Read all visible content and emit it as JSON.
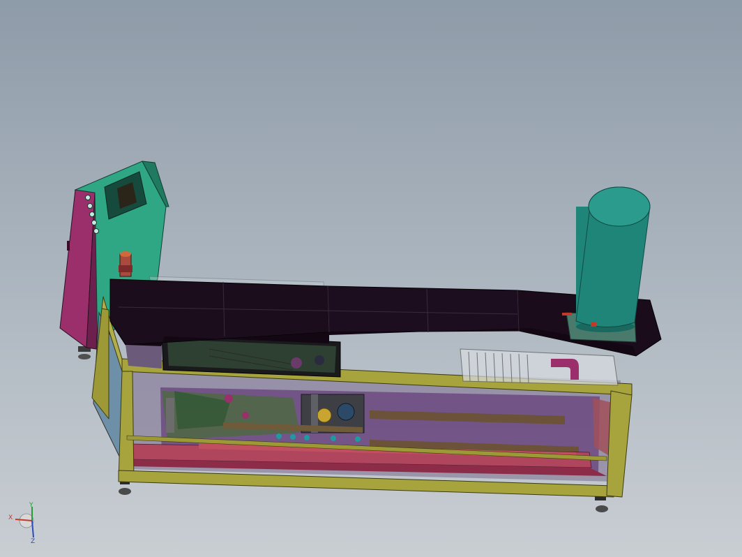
{
  "viewport": {
    "background_top": "#8e9ba8",
    "background_bottom": "#c9ced3"
  },
  "model": {
    "parts": [
      "control-cabinet",
      "hmi-panel",
      "emergency-stop-button",
      "machine-frame",
      "top-cover",
      "cylindrical-tank",
      "drive-motor",
      "gear-rack",
      "roller-conveyor",
      "leveling-foot"
    ],
    "colors": {
      "frame": "#a7a43e",
      "cabinet": "#9a2f6c",
      "hmi": "#2fa785",
      "tank": "#1f8579",
      "cover": "#1b0d1c",
      "rails": "#b0455e",
      "inner": "#5a2c72"
    }
  },
  "triad": {
    "x_label": "X",
    "y_label": "Y",
    "z_label": "Z"
  }
}
